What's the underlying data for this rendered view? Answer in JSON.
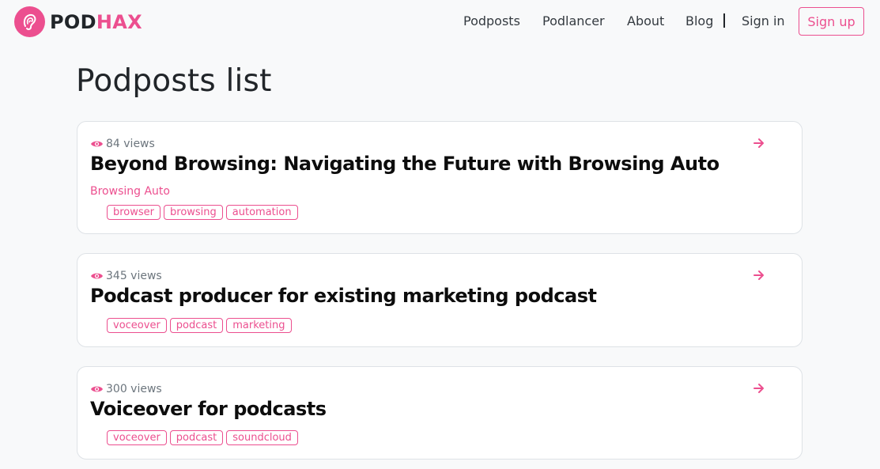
{
  "brand": {
    "name_part1": "POD",
    "name_part2": "HAX",
    "accent_color": "#ec4f8f",
    "logo_icon": "ear-icon"
  },
  "nav": {
    "links": [
      "Podposts",
      "Podlancer",
      "About",
      "Blog"
    ],
    "sign_in": "Sign in",
    "sign_up": "Sign up"
  },
  "page": {
    "title": "Podposts list"
  },
  "posts": [
    {
      "views": "84 views",
      "title": "Beyond Browsing: Navigating the Future with Browsing Auto",
      "company": "Browsing Auto",
      "tags": [
        "browser",
        "browsing",
        "automation"
      ]
    },
    {
      "views": "345 views",
      "title": "Podcast producer for existing marketing podcast",
      "tags": [
        "voceover",
        "podcast",
        "marketing"
      ]
    },
    {
      "views": "300 views",
      "title": "Voiceover for podcasts",
      "tags": [
        "voceover",
        "podcast",
        "soundcloud"
      ]
    }
  ]
}
